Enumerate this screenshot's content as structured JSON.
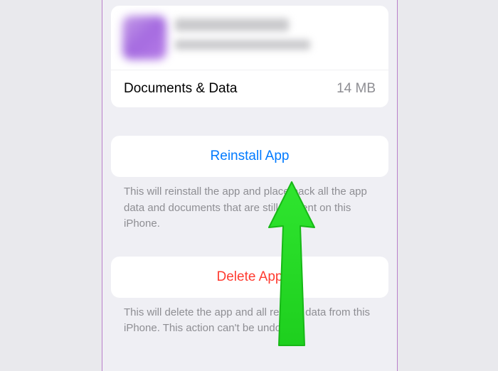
{
  "appHeader": {
    "documentsLabel": "Documents & Data",
    "documentsSize": "14 MB"
  },
  "reinstall": {
    "buttonLabel": "Reinstall App",
    "caption": "This will reinstall the app and place back all the app data and documents that are still present on this iPhone."
  },
  "delete": {
    "buttonLabel": "Delete App",
    "caption": "This will delete the app and all related data from this iPhone. This action can't be undone."
  }
}
